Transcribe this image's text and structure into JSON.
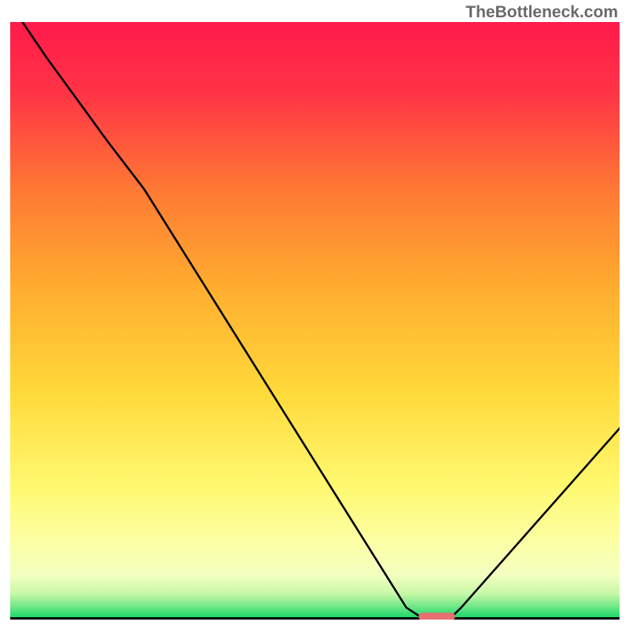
{
  "watermark": "TheBottleneck.com",
  "chart_data": {
    "type": "line",
    "title": "",
    "xlabel": "",
    "ylabel": "",
    "xlim": [
      0,
      100
    ],
    "ylim": [
      0,
      100
    ],
    "gradient_background": {
      "top": "#ff1a4a",
      "upper_mid": "#ff9a2a",
      "mid": "#ffd93a",
      "lower_mid": "#ffff8a",
      "lower": "#faffb0",
      "bottom": "#20dd70"
    },
    "curve": {
      "description": "Bottleneck curve (V-shape)",
      "x": [
        0,
        6,
        16,
        22,
        65,
        68,
        72,
        74,
        100
      ],
      "y": [
        103,
        94,
        80,
        72,
        2,
        0,
        0,
        2,
        32
      ]
    },
    "marker": {
      "shape": "rounded-bar",
      "color": "#e77070",
      "x_center": 70,
      "y": 0.5,
      "width": 6,
      "height": 1.3
    }
  }
}
